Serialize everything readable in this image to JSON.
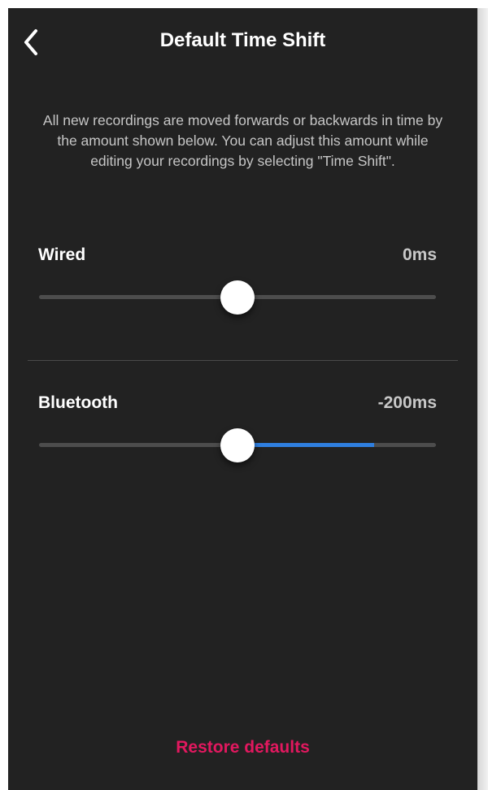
{
  "header": {
    "title": "Default Time Shift",
    "back_icon": "chevron-left-icon"
  },
  "description": "All new recordings are moved forwards or backwards in time by the amount shown below. You can adjust this amount while editing your recordings by selecting \"Time Shift\".",
  "settings": [
    {
      "label": "Wired",
      "value_text": "0ms",
      "thumb_fraction": 0.5,
      "fill_fraction": null
    },
    {
      "label": "Bluetooth",
      "value_text": "-200ms",
      "thumb_fraction": 0.5,
      "fill_fraction": 0.845
    }
  ],
  "restore_label": "Restore defaults",
  "colors": {
    "background": "#222222",
    "track": "#4d4d4d",
    "fill": "#2f7fe0",
    "accent": "#e2185f",
    "text": "#ffffff"
  }
}
